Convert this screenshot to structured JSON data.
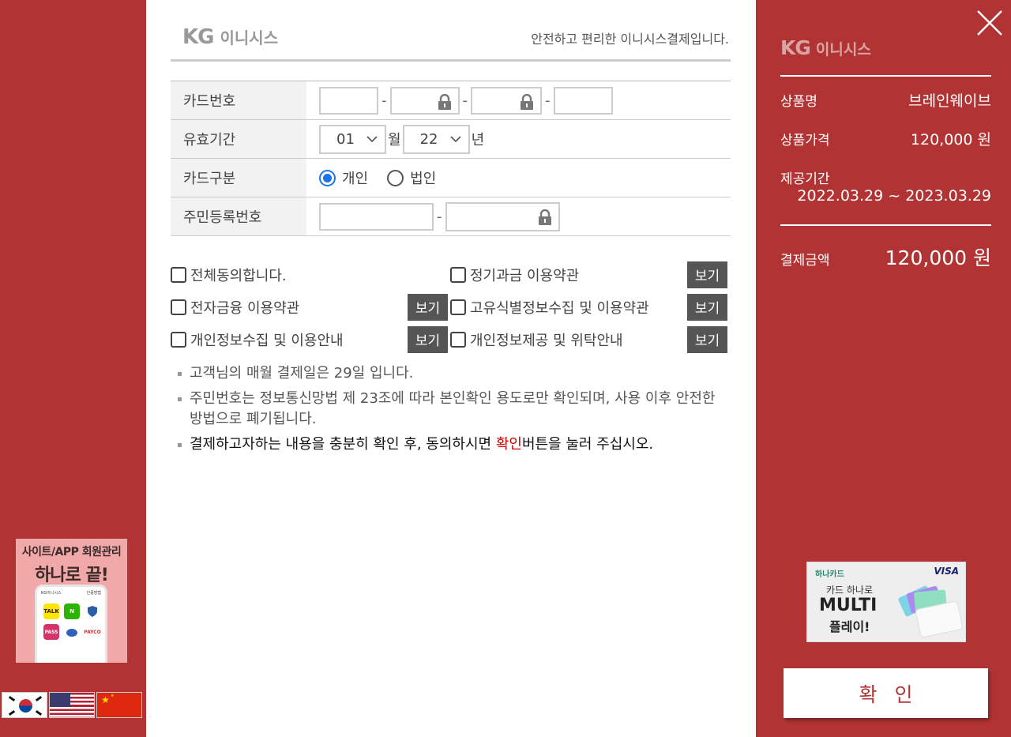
{
  "left_ad": {
    "line1": "사이트/APP 회원관리",
    "line2": "하나로 끝!",
    "phone_brand": "KG이니시스",
    "phone_menu": "인증방법",
    "apps": [
      "TALK",
      "N",
      "",
      "PASS",
      "",
      "PAYCO"
    ]
  },
  "languages": [
    "한국어",
    "English",
    "中文"
  ],
  "header": {
    "logo_kg": "KG",
    "logo_name": "이니시스",
    "tagline": "안전하고 편리한 이니시스결제입니다."
  },
  "form": {
    "card_number_label": "카드번호",
    "expiry_label": "유효기간",
    "expiry_month": "01",
    "month_unit": "월",
    "expiry_year": "22",
    "year_unit": "년",
    "card_type_label": "카드구분",
    "card_type_personal": "개인",
    "card_type_corporate": "법인",
    "resident_number_label": "주민등록번호",
    "separator": "-"
  },
  "terms": {
    "agree_all": "전체동의합니다.",
    "recurring": "정기과금 이용약관",
    "e_finance": "전자금융 이용약관",
    "unique_id": "고유식별정보수집 및 이용약관",
    "privacy_collect": "개인정보수집 및 이용안내",
    "privacy_provide": "개인정보제공 및 위탁안내",
    "view_label": "보기"
  },
  "notes": {
    "n1": "고객님의 매월 결제일은 29일 입니다.",
    "n2": "주민번호는 정보통신망법 제 23조에 따라 본인확인 용도로만 확인되며, 사용 이후 안전한 방법으로 폐기됩니다.",
    "n3_pre": "결제하고자하는 내용을 충분히 확인 후, 동의하시면 ",
    "n3_highlight": "확인",
    "n3_post": "버튼을 눌러 주십시오."
  },
  "summary": {
    "logo_kg": "KG",
    "logo_name": "이니시스",
    "product_label": "상품명",
    "product_value": "브레인웨이브",
    "price_label": "상품가격",
    "price_value": "120,000 원",
    "period_label": "제공기간",
    "period_value": "2022.03.29 ~ 2023.03.29",
    "amount_label": "결제금액",
    "amount_value": "120,000 원"
  },
  "right_ad": {
    "bank": "하나카드",
    "network": "VISA",
    "line1": "카드 하나로",
    "line2": "MULTI",
    "line3": "플레이!"
  },
  "confirm_label": "확인",
  "colors": {
    "brand_red": "#b23333",
    "radio_blue": "#1a73e8",
    "highlight_red": "#cc0000"
  }
}
